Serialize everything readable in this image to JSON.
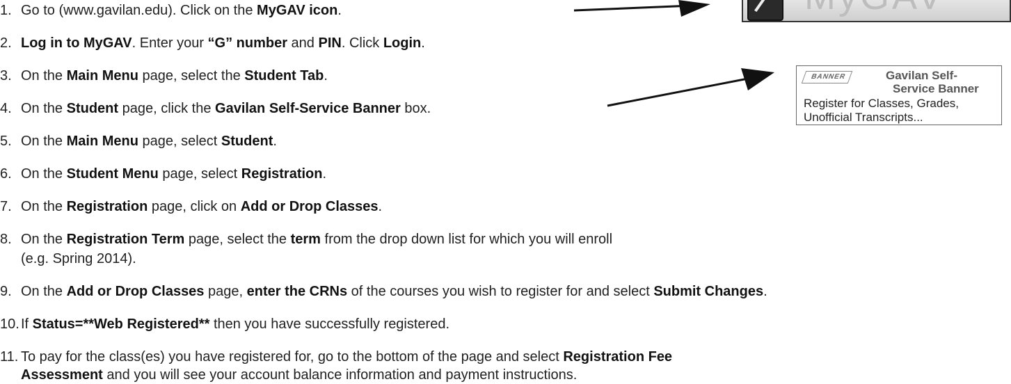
{
  "mygav_logo": {
    "wordmark": "MyGAV",
    "icon": "arrow-pointer-icon"
  },
  "banner_box": {
    "logo_text": "BANNER",
    "title_line1": "Gavilan Self-",
    "title_line2": "Service Banner",
    "desc_line1": "Register for Classes, Grades,",
    "desc_line2": "Unofficial Transcripts..."
  },
  "steps": [
    {
      "num": "1.",
      "t1": "Go to (www.gavilan.edu). Click on the ",
      "b1": "MyGAV icon",
      "t2": "."
    },
    {
      "num": "2.",
      "b1": "Log in to MyGAV",
      "t1": ". Enter your ",
      "b2": "“G” number",
      "t2": " and ",
      "b3": "PIN",
      "t3": ".  Click ",
      "b4": "Login",
      "t4": "."
    },
    {
      "num": "3.",
      "t1": "On the ",
      "b1": "Main Menu",
      "t2": " page, select the ",
      "b2": "Student Tab",
      "t3": "."
    },
    {
      "num": "4.",
      "t1": "On the ",
      "b1": "Student",
      "t2": " page, click the ",
      "b2": "Gavilan Self-Service Banner",
      "t3": " box."
    },
    {
      "num": "5.",
      "t1": "On the ",
      "b1": "Main Menu",
      "t2": " page, select ",
      "b2": "Student",
      "t3": "."
    },
    {
      "num": "6.",
      "t1": "On the ",
      "b1": "Student Menu",
      "t2": " page, select ",
      "b2": "Registration",
      "t3": "."
    },
    {
      "num": "7.",
      "t1": "On the ",
      "b1": "Registration",
      "t2": " page, click on ",
      "b2": "Add or Drop Classes",
      "t3": "."
    },
    {
      "num": "8.",
      "t1": "On the ",
      "b1": "Registration Term",
      "t2": " page, select the ",
      "b2": "term",
      "t3": " from the drop down list for which you will enroll",
      "cont": "(e.g. Spring 2014)."
    },
    {
      "num": "9.",
      "t1": "On the ",
      "b1": "Add or Drop Classes",
      "t2": " page, ",
      "b2": "enter the CRNs",
      "t3": " of the courses you wish to register for and select ",
      "b3": "Submit Changes",
      "t4": "."
    },
    {
      "num": "10.",
      "t1": "If ",
      "b1": "Status=**Web Registered**",
      "t2": " then you have successfully registered."
    },
    {
      "num": "11.",
      "t1": "To pay for the class(es) you have registered for, go to the bottom of the page and select ",
      "b1": "Registration Fee",
      "cont_b": "Assessment",
      "cont_t": " and you will see your account balance information and payment instructions."
    }
  ]
}
